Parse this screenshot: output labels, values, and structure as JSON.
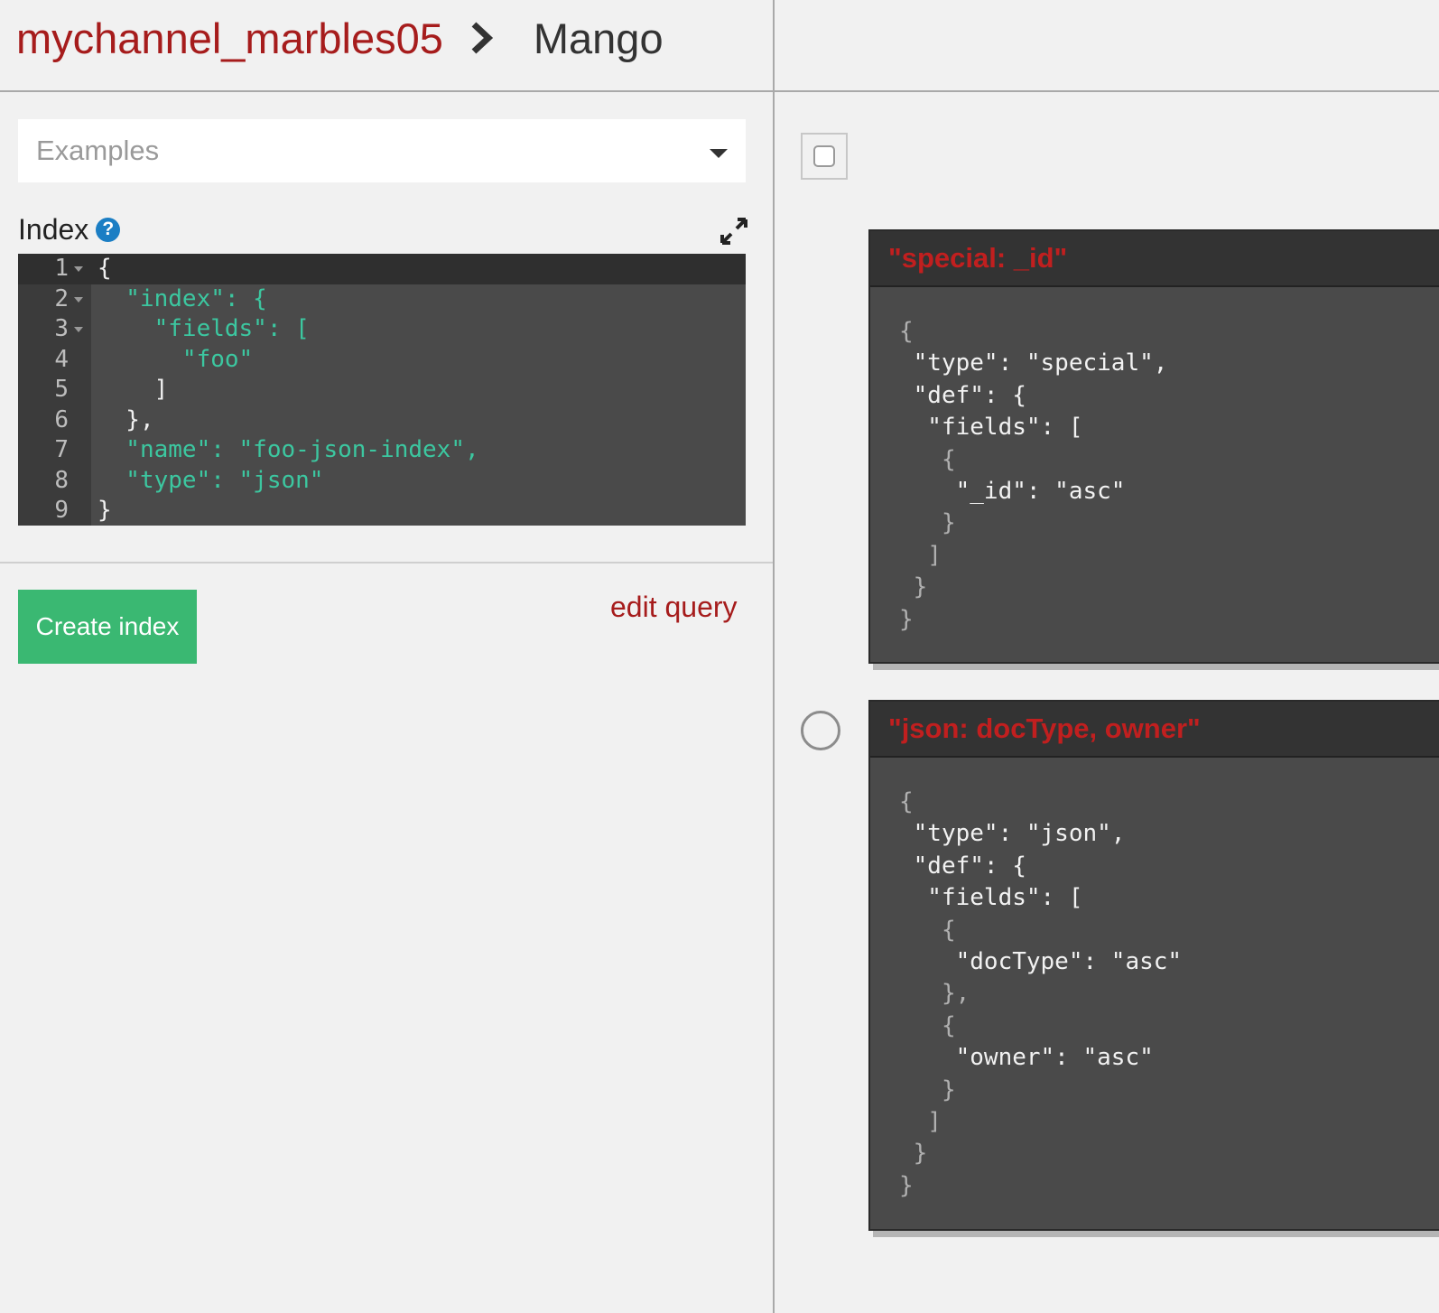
{
  "breadcrumb": {
    "database": "mychannel_marbles05",
    "page": "Mango"
  },
  "examples_dropdown": {
    "selected": "Examples"
  },
  "index_section": {
    "label": "Index",
    "help_icon": "question-circle-icon",
    "expand_icon": "expand-arrows-icon"
  },
  "editor": {
    "lines": [
      {
        "num": "1",
        "text": "{"
      },
      {
        "num": "2",
        "text": "  \"index\": {"
      },
      {
        "num": "3",
        "text": "    \"fields\": ["
      },
      {
        "num": "4",
        "text": "      \"foo\""
      },
      {
        "num": "5",
        "text": "    ]"
      },
      {
        "num": "6",
        "text": "  },"
      },
      {
        "num": "7",
        "text": "  \"name\": \"foo-json-index\","
      },
      {
        "num": "8",
        "text": "  \"type\": \"json\""
      },
      {
        "num": "9",
        "text": "}"
      }
    ]
  },
  "actions": {
    "create_index": "Create index",
    "edit_query": "edit query"
  },
  "indexes": [
    {
      "title": "\"special: _id\"",
      "json_lines": [
        "{",
        " \"type\": \"special\",",
        " \"def\": {",
        "  \"fields\": [",
        "   {",
        "    \"_id\": \"asc\"",
        "   }",
        "  ]",
        " }",
        "}"
      ]
    },
    {
      "title": "\"json: docType, owner\"",
      "json_lines": [
        "{",
        " \"type\": \"json\",",
        " \"def\": {",
        "  \"fields\": [",
        "   {",
        "    \"docType\": \"asc\"",
        "   },",
        "   {",
        "    \"owner\": \"asc\"",
        "   }",
        "  ]",
        " }",
        "}"
      ]
    }
  ],
  "colors": {
    "brand_red": "#a61c1c",
    "button_green": "#3ab872",
    "help_blue": "#1b7ec4",
    "code_string": "#3cc7a0"
  }
}
